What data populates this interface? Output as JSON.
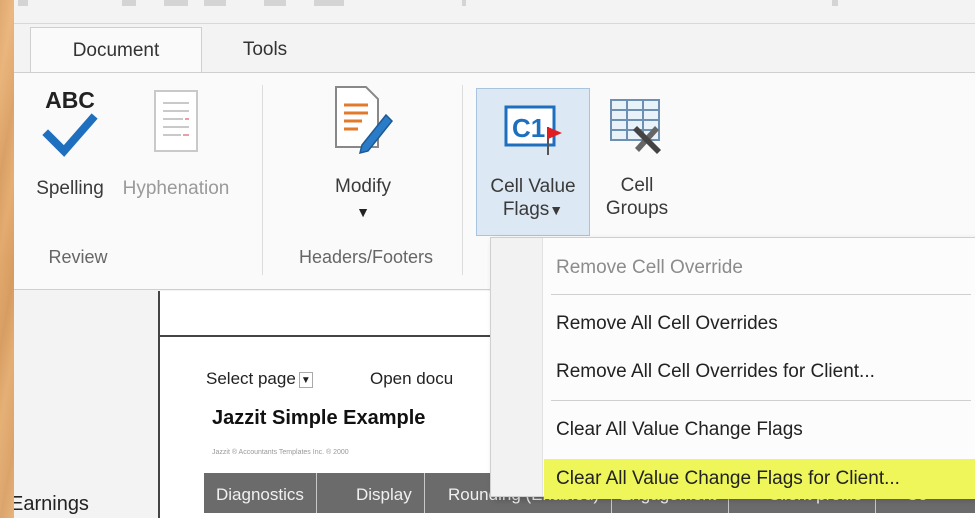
{
  "ribbon": {
    "tabs": [
      {
        "label": "Document",
        "active": true
      },
      {
        "label": "Tools",
        "active": false
      }
    ],
    "groups": {
      "review": {
        "label": "Review",
        "spelling": {
          "icon_text": "ABC",
          "label": "Spelling"
        },
        "hyphenation": {
          "label": "Hyphenation"
        }
      },
      "headers_footers": {
        "label": "Headers/Footers",
        "modify": {
          "label": "Modify"
        }
      },
      "cells": {
        "cell_value_flags": {
          "icon_text": "C1",
          "label_line1": "Cell Value",
          "label_line2": "Flags"
        },
        "cell_groups": {
          "label_line1": "Cell",
          "label_line2": "Groups"
        }
      }
    }
  },
  "dropdown_menu": {
    "items": [
      {
        "label": "Remove Cell Override",
        "disabled": true
      },
      {
        "label": "Remove All Cell Overrides",
        "disabled": false
      },
      {
        "label": "Remove All Cell Overrides for Client...",
        "disabled": false
      },
      {
        "label": "Clear All Value Change Flags",
        "disabled": false
      },
      {
        "label": "Clear All Value Change Flags for Client...",
        "disabled": false,
        "highlighted": true
      }
    ],
    "highlight_color": "#eef65a"
  },
  "document": {
    "select_page": "Select page",
    "open_document": "Open docu",
    "title": "Jazzit Simple Example",
    "fine_print": "Jazzit ® Accountants Templates Inc. ® 2000",
    "nav_items": [
      "Diagnostics",
      "Display",
      "Rounding (Enabled)",
      "Engagement",
      "Client profile",
      "Co"
    ],
    "left_label": "Earnings"
  },
  "colors": {
    "accent_blue": "#1f6fbf",
    "pressed_bg": "#dce8f3",
    "navbar_bg": "#6b6b6b",
    "flag_red": "#e02020"
  }
}
